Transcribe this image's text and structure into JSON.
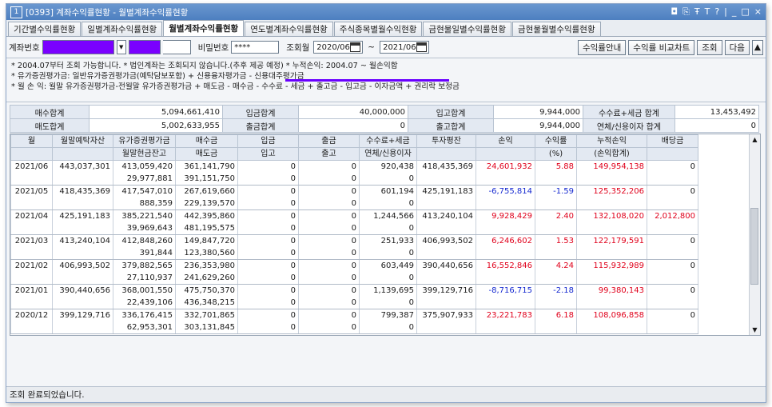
{
  "window": {
    "icon": "1",
    "title": "[0393] 계좌수익률현황 - 월별계좌수익률현황",
    "controls": [
      "◘",
      "⎘",
      "Ŧ",
      "T",
      "?",
      "|",
      "_",
      "□",
      "×"
    ]
  },
  "tabs": [
    {
      "label": "기간별수익률현황"
    },
    {
      "label": "일별계좌수익률현황"
    },
    {
      "label": "월별계좌수익률현황"
    },
    {
      "label": "연도별계좌수익률현황"
    },
    {
      "label": "주식종목별월수익현황"
    },
    {
      "label": "금현물일별수익률현황"
    },
    {
      "label": "금현물월별수익률현황"
    }
  ],
  "toolbar": {
    "account_label": "계좌번호",
    "password_label": "비밀번호",
    "password_value": "****",
    "period_label": "조회월",
    "from_date": "2020/06",
    "tilde": "~",
    "to_date": "2021/06",
    "guide_button": "수익률안내",
    "compare_button": "수익률 비교차트",
    "query_button": "조회",
    "next_button": "다음",
    "up_button": "▲"
  },
  "notes": [
    "* 2004.07부터 조회 가능합니다.   * 법인계좌는 조회되지 않습니다.(추후 제공 예정)   * 누적손익: 2004.07 ~ 월손익합",
    "* 유가증권평가금: 일반유가증권평가금(예탁담보포함) + 신용융자평가금 - 신용대주평가금",
    "* 월 손 익: 월말 유가증권평가금-전월말 유가증권평가금 + 매도금 - 매수금 - 수수료 - 세금 + 출고금 - 입고금 - 이자금액 + 권리락 보정금"
  ],
  "summary": {
    "buy_total_label": "매수합계",
    "buy_total": "5,094,661,410",
    "deposit_total_label": "입금합계",
    "deposit_total": "40,000,000",
    "in_total_label": "입고합계",
    "in_total": "9,944,000",
    "fee_tax_label": "수수료+세금 합계",
    "fee_tax": "13,453,492",
    "sell_total_label": "매도합계",
    "sell_total": "5,002,633,955",
    "withdraw_total_label": "출금합계",
    "withdraw_total": "0",
    "out_total_label": "출고합계",
    "out_total": "9,944,000",
    "overdue_label": "연체/신용이자 합계",
    "overdue": "0"
  },
  "grid": {
    "headers_top": [
      "월",
      "월말예탁자산",
      "유가증권평가금",
      "매수금",
      "입금",
      "출금",
      "수수료+세금",
      "투자평잔",
      "손익",
      "수익률",
      "누적손익",
      "배당금"
    ],
    "headers_bottom": [
      "",
      "",
      "월말현금잔고",
      "매도금",
      "입고",
      "출고",
      "연체/신용이자",
      "",
      "",
      "(%)",
      "(손익합계)",
      ""
    ],
    "rows": [
      {
        "month": "2021/06",
        "asset": "443,037,301",
        "stock_eval": "413,059,420",
        "cash": "29,977,881",
        "buy": "361,141,790",
        "sell": "391,151,750",
        "dep": "0",
        "in": "0",
        "wd": "0",
        "out": "0",
        "fee": "920,438",
        "overdue": "0",
        "avg": "418,435,369",
        "pnl": "24,601,932",
        "rate": "5.88",
        "cum": "149,954,138",
        "div": "0",
        "sign": "pos"
      },
      {
        "month": "2021/05",
        "asset": "418,435,369",
        "stock_eval": "417,547,010",
        "cash": "888,359",
        "buy": "267,619,660",
        "sell": "229,139,570",
        "dep": "0",
        "in": "0",
        "wd": "0",
        "out": "0",
        "fee": "601,194",
        "overdue": "0",
        "avg": "425,191,183",
        "pnl": "-6,755,814",
        "rate": "-1.59",
        "cum": "125,352,206",
        "div": "0",
        "sign": "neg"
      },
      {
        "month": "2021/04",
        "asset": "425,191,183",
        "stock_eval": "385,221,540",
        "cash": "39,969,643",
        "buy": "442,395,860",
        "sell": "481,195,575",
        "dep": "0",
        "in": "0",
        "wd": "0",
        "out": "0",
        "fee": "1,244,566",
        "overdue": "0",
        "avg": "413,240,104",
        "pnl": "9,928,429",
        "rate": "2.40",
        "cum": "132,108,020",
        "div": "2,012,800",
        "sign": "pos"
      },
      {
        "month": "2021/03",
        "asset": "413,240,104",
        "stock_eval": "412,848,260",
        "cash": "391,844",
        "buy": "149,847,720",
        "sell": "123,380,560",
        "dep": "0",
        "in": "0",
        "wd": "0",
        "out": "0",
        "fee": "251,933",
        "overdue": "0",
        "avg": "406,993,502",
        "pnl": "6,246,602",
        "rate": "1.53",
        "cum": "122,179,591",
        "div": "0",
        "sign": "pos"
      },
      {
        "month": "2021/02",
        "asset": "406,993,502",
        "stock_eval": "379,882,565",
        "cash": "27,110,937",
        "buy": "236,353,980",
        "sell": "241,629,260",
        "dep": "0",
        "in": "0",
        "wd": "0",
        "out": "0",
        "fee": "603,449",
        "overdue": "0",
        "avg": "390,440,656",
        "pnl": "16,552,846",
        "rate": "4.24",
        "cum": "115,932,989",
        "div": "0",
        "sign": "pos"
      },
      {
        "month": "2021/01",
        "asset": "390,440,656",
        "stock_eval": "368,001,550",
        "cash": "22,439,106",
        "buy": "475,750,370",
        "sell": "436,348,215",
        "dep": "0",
        "in": "0",
        "wd": "0",
        "out": "0",
        "fee": "1,139,695",
        "overdue": "0",
        "avg": "399,129,716",
        "pnl": "-8,716,715",
        "rate": "-2.18",
        "cum": "99,380,143",
        "div": "0",
        "sign": "neg"
      },
      {
        "month": "2020/12",
        "asset": "399,129,716",
        "stock_eval": "336,176,415",
        "cash": "62,953,301",
        "buy": "332,701,865",
        "sell": "303,131,845",
        "dep": "0",
        "in": "0",
        "wd": "0",
        "out": "0",
        "fee": "799,387",
        "overdue": "0",
        "avg": "375,907,933",
        "pnl": "23,221,783",
        "rate": "6.18",
        "cum": "108,096,858",
        "div": "0",
        "sign": "pos"
      }
    ]
  },
  "status": "조회 완료되었습니다.",
  "colors": {
    "positive": "#e0001b",
    "negative": "#1428d0",
    "masked": "#7a00ff"
  }
}
